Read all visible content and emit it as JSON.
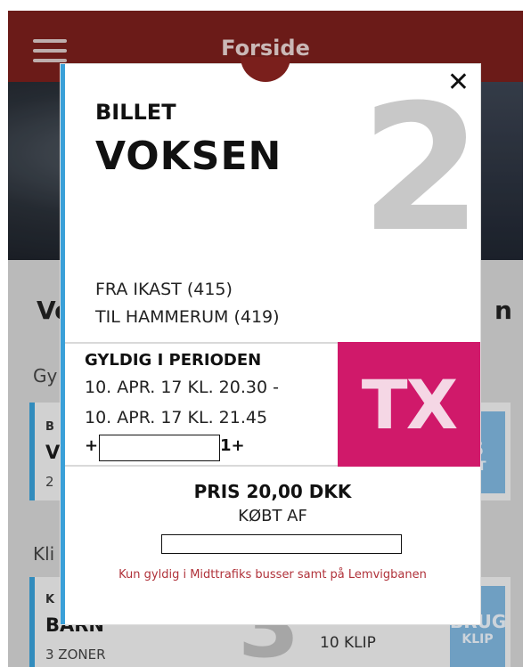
{
  "app": {
    "title": "Forside",
    "background": {
      "heading_left": "Ve",
      "heading_right": "n",
      "section1": "Gy",
      "section2": "Kli",
      "card1": {
        "line1": "B",
        "line2": "V",
        "line3": "2",
        "btn_line1": "S",
        "btn_line2": "ET"
      },
      "card2": {
        "line1": "K",
        "line2": "BARN",
        "line3": "3 ZONER",
        "big_number": "3",
        "clips_label": "10 KLIP",
        "btn_line1": "BRUG",
        "btn_line2": "KLIP"
      }
    }
  },
  "ticket": {
    "type_label": "BILLET",
    "type_value": "VOKSEN",
    "zone_number": "2",
    "route_from": "FRA IKAST (415)",
    "route_to": "TIL HAMMERUM (419)",
    "period_heading": "GYLDIG I PERIODEN",
    "period_start": "10. APR. 17 KL. 20.30 -",
    "period_end": "10. APR. 17 KL. 21.45",
    "phone_prefix": "+",
    "phone_suffix": "1+",
    "operator_logo": "TX",
    "price": "PRIS 20,00 DKK",
    "bought_by": "KØBT AF",
    "disclaimer": "Kun gyldig i Midttrafiks busser samt på Lemvigbanen",
    "colors": {
      "accent_blue": "#3aa0d8",
      "tx_pink": "#d0196a",
      "topbar": "#7a1f1c",
      "disclaimer_red": "#b0323a"
    }
  }
}
